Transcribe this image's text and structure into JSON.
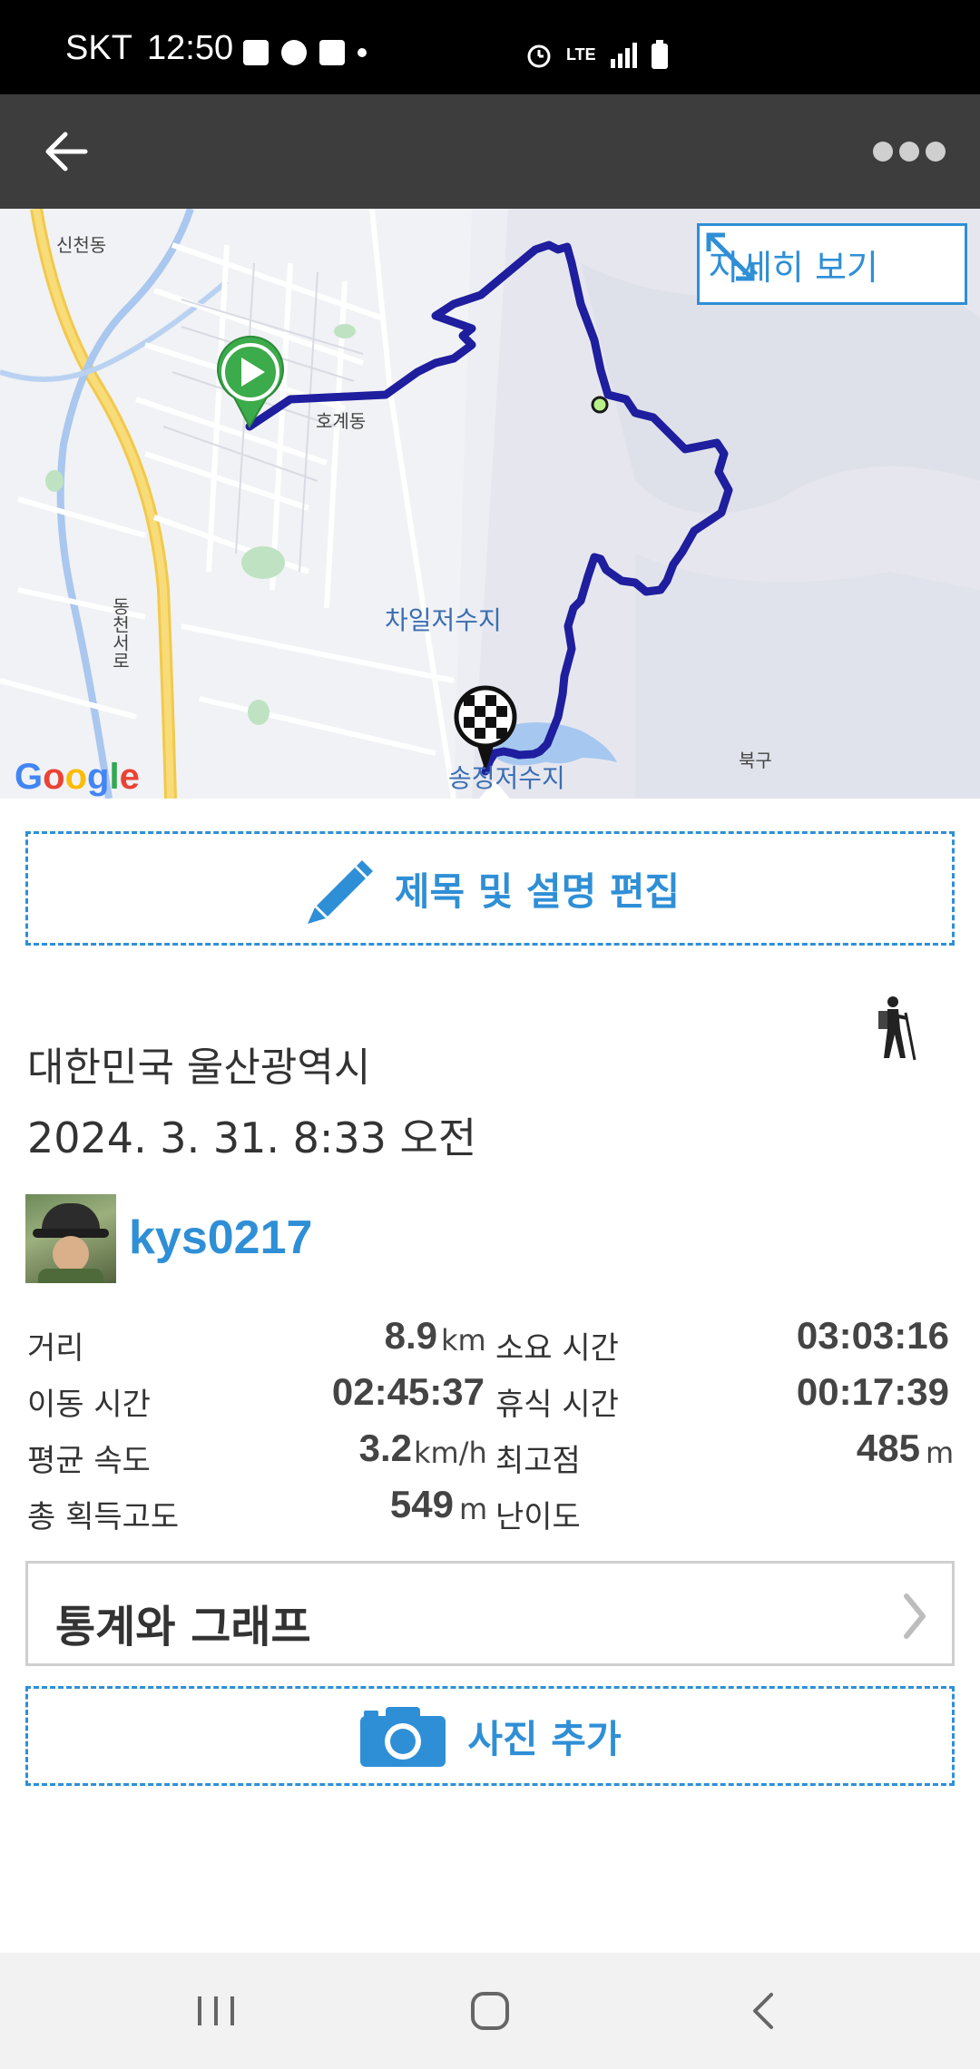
{
  "status_bar": {
    "carrier": "SKT",
    "time": "12:50",
    "network": "LTE"
  },
  "app_bar": {
    "back_icon": "arrow-left-icon",
    "more_icon": "more-horizontal-icon"
  },
  "map": {
    "detail_button_label": "자세히 보기",
    "labels": {
      "sincheon": "신천동",
      "hogye": "호계동",
      "chail_reservoir": "차일저수지",
      "songjeong_reservoir": "송정저수지",
      "dongcheon_road": "동천서로",
      "bukgu": "북구"
    },
    "logo_letters": [
      "G",
      "o",
      "o",
      "g",
      "l",
      "e"
    ],
    "colors": {
      "track": "#1e1e9e",
      "start": "#3cab4b"
    }
  },
  "edit_button_label": "제목 및 설명 편집",
  "location": "대한민국 울산광역시",
  "datetime": "2024. 3. 31. 8:33 오전",
  "user": {
    "name": "kys0217"
  },
  "stats": {
    "distance": {
      "label": "거리",
      "value": "8.9",
      "unit": "km"
    },
    "total_time": {
      "label": "소요 시간",
      "value": "03:03:16"
    },
    "moving_time": {
      "label": "이동 시간",
      "value": "02:45:37"
    },
    "rest_time": {
      "label": "휴식 시간",
      "value": "00:17:39"
    },
    "avg_speed": {
      "label": "평균 속도",
      "value": "3.2",
      "unit": "km/h"
    },
    "max_altitude": {
      "label": "최고점",
      "value": "485",
      "unit": "m"
    },
    "total_ascent": {
      "label": "총 획득고도",
      "value": "549",
      "unit": "m"
    },
    "difficulty": {
      "label": "난이도"
    }
  },
  "stats_button_label": "통계와 그래프",
  "photo_button_label": "사진 추가",
  "accent_color": "#2f8fd6"
}
